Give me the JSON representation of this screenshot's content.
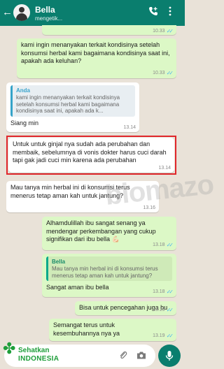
{
  "header": {
    "back_icon": "arrow-left-icon",
    "contact_name": "Bella",
    "status": "mengetik...",
    "bg_color": "#0a7e6e"
  },
  "messages": [
    {
      "time": "10.33"
    },
    {
      "text": "kami ingin menanyakan terkait kondisinya setelah konsumsi herbal kami bagaimana kondisinya saat ini, apakah ada keluhan?",
      "time": "10.33"
    },
    {
      "quote_author": "Anda",
      "quote_text": "kami ingin menanyakan terkait kondisinya setelah konsumsi herbal kami bagaimana kondisinya saat ini, apakah ada k...",
      "text": "Siang min",
      "time": "13.14"
    },
    {
      "text": "Untuk untuk ginjal nya sudah ada perubahan dan membaik, sebelumnya di vonis dokter harus cuci darah tapi gak jadi cuci min karena ada perubahan",
      "time": "13.14"
    },
    {
      "text": "Mau tanya min herbal ini di konsumsi terus menerus tetap aman kah untuk jantung?",
      "time": "13.16"
    },
    {
      "text": "Alhamdulillah ibu sangat senang ya mendengar perkembangan yang cukup signifikan dari ibu bella 💪🏻",
      "time": "13.18"
    },
    {
      "quote_author": "Bella",
      "quote_text": "Mau tanya min herbal ini di konsumsi terus menerus tetap aman kah untuk jantung?",
      "text": "Sangat aman ibu bella",
      "time": "13.18"
    },
    {
      "text": "Bisa untuk pencegahan juga bu",
      "time": "13.19"
    },
    {
      "text": "Semangat terus untuk kesembuhannya nya ya",
      "time": "13.19"
    }
  ],
  "watermark": "biomazo",
  "logo": {
    "top": "Sehatkan",
    "bottom": "INDONESIA"
  },
  "accent": "#0a7e6e",
  "highlight_color": "#e0262b"
}
